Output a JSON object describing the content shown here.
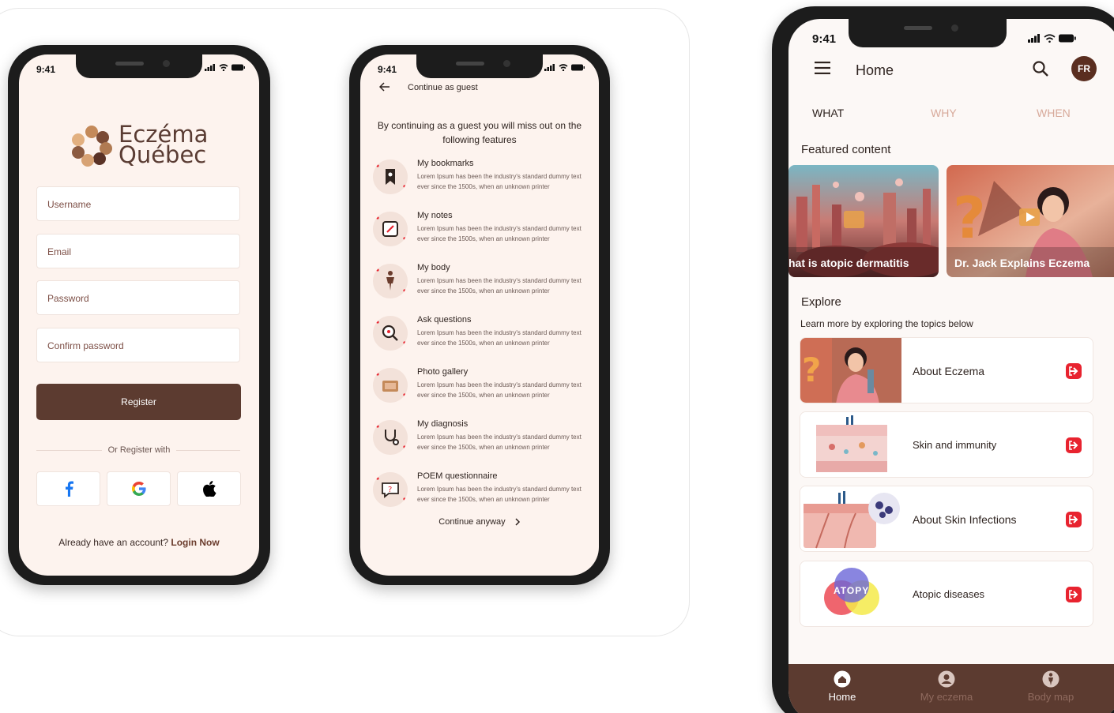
{
  "status": {
    "time": "9:41"
  },
  "register": {
    "logo_line1": "Eczéma",
    "logo_line2": "Québec",
    "username_placeholder": "Username",
    "email_placeholder": "Email",
    "password_placeholder": "Password",
    "confirm_placeholder": "Confirm password",
    "register_label": "Register",
    "or_label": "Or Register with",
    "already_text": "Already have an account? ",
    "login_link": "Login Now"
  },
  "guest": {
    "header": "Continue as guest",
    "intro": "By continuing as a guest you will miss out on the following features",
    "features": [
      {
        "title": "My bookmarks",
        "desc": "Lorem Ipsum has been the industry's standard dummy text ever since the 1500s, when an unknown printer",
        "icon": "bookmark-icon"
      },
      {
        "title": "My notes",
        "desc": "Lorem Ipsum has been the industry's standard dummy text ever since the 1500s, when an unknown printer",
        "icon": "notes-icon"
      },
      {
        "title": "My body",
        "desc": "Lorem Ipsum has been the industry's standard dummy text ever since the 1500s, when an unknown printer",
        "icon": "body-icon"
      },
      {
        "title": "Ask questions",
        "desc": "Lorem Ipsum has been the industry's standard dummy text ever since the 1500s, when an unknown printer",
        "icon": "question-search-icon"
      },
      {
        "title": "Photo gallery",
        "desc": "Lorem Ipsum has been the industry's standard dummy text ever since the 1500s, when an unknown printer",
        "icon": "photo-icon"
      },
      {
        "title": "My diagnosis",
        "desc": "Lorem Ipsum has been the industry's standard dummy text ever since the 1500s, when an unknown printer",
        "icon": "stethoscope-icon"
      },
      {
        "title": "POEM questionnaire",
        "desc": "Lorem Ipsum has been the industry's standard dummy text ever since the 1500s, when an unknown printer",
        "icon": "chat-question-icon"
      }
    ],
    "continue_label": "Continue anyway"
  },
  "home": {
    "title": "Home",
    "avatar_initials": "FR",
    "tabs": [
      "WHAT",
      "WHY",
      "WHEN"
    ],
    "featured_title": "Featured content",
    "featured": [
      {
        "caption": "hat is atopic dermatitis"
      },
      {
        "caption": "Dr. Jack Explains Eczema"
      }
    ],
    "explore_title": "Explore",
    "explore_sub": "Learn more by exploring the topics below",
    "topics": [
      {
        "label": "About Eczema"
      },
      {
        "label": "Skin and immunity"
      },
      {
        "label": "About Skin Infections"
      },
      {
        "label": "Atopic diseases"
      }
    ],
    "atopy_badge": "ATOPY",
    "nav": [
      {
        "label": "Home"
      },
      {
        "label": "My eczema"
      },
      {
        "label": "Body map"
      }
    ],
    "colors": {
      "brand": "#5c3b30",
      "accent": "#e8232f",
      "screen_bg": "#fdf3ee"
    }
  }
}
